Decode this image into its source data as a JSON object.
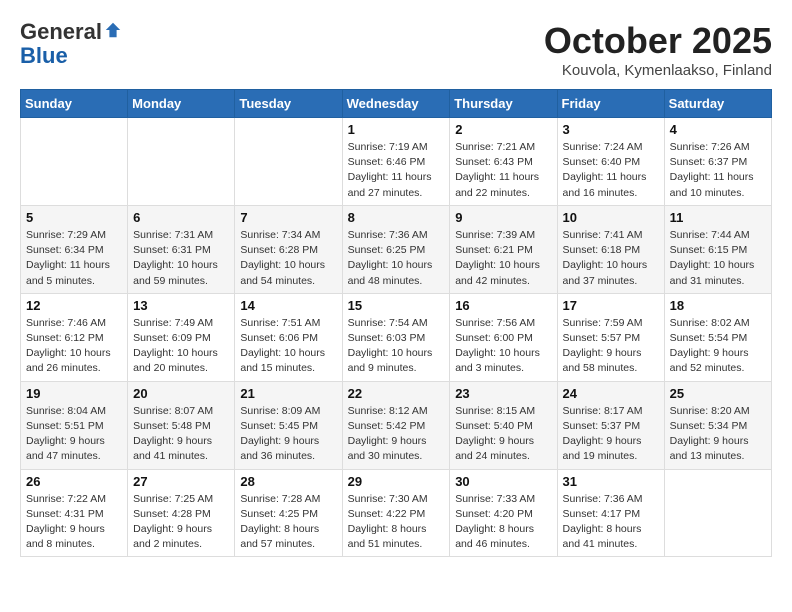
{
  "logo": {
    "general": "General",
    "blue": "Blue"
  },
  "header": {
    "month": "October 2025",
    "location": "Kouvola, Kymenlaakso, Finland"
  },
  "weekdays": [
    "Sunday",
    "Monday",
    "Tuesday",
    "Wednesday",
    "Thursday",
    "Friday",
    "Saturday"
  ],
  "weeks": [
    [
      {
        "day": "",
        "sunrise": "",
        "sunset": "",
        "daylight": ""
      },
      {
        "day": "",
        "sunrise": "",
        "sunset": "",
        "daylight": ""
      },
      {
        "day": "",
        "sunrise": "",
        "sunset": "",
        "daylight": ""
      },
      {
        "day": "1",
        "sunrise": "Sunrise: 7:19 AM",
        "sunset": "Sunset: 6:46 PM",
        "daylight": "Daylight: 11 hours and 27 minutes."
      },
      {
        "day": "2",
        "sunrise": "Sunrise: 7:21 AM",
        "sunset": "Sunset: 6:43 PM",
        "daylight": "Daylight: 11 hours and 22 minutes."
      },
      {
        "day": "3",
        "sunrise": "Sunrise: 7:24 AM",
        "sunset": "Sunset: 6:40 PM",
        "daylight": "Daylight: 11 hours and 16 minutes."
      },
      {
        "day": "4",
        "sunrise": "Sunrise: 7:26 AM",
        "sunset": "Sunset: 6:37 PM",
        "daylight": "Daylight: 11 hours and 10 minutes."
      }
    ],
    [
      {
        "day": "5",
        "sunrise": "Sunrise: 7:29 AM",
        "sunset": "Sunset: 6:34 PM",
        "daylight": "Daylight: 11 hours and 5 minutes."
      },
      {
        "day": "6",
        "sunrise": "Sunrise: 7:31 AM",
        "sunset": "Sunset: 6:31 PM",
        "daylight": "Daylight: 10 hours and 59 minutes."
      },
      {
        "day": "7",
        "sunrise": "Sunrise: 7:34 AM",
        "sunset": "Sunset: 6:28 PM",
        "daylight": "Daylight: 10 hours and 54 minutes."
      },
      {
        "day": "8",
        "sunrise": "Sunrise: 7:36 AM",
        "sunset": "Sunset: 6:25 PM",
        "daylight": "Daylight: 10 hours and 48 minutes."
      },
      {
        "day": "9",
        "sunrise": "Sunrise: 7:39 AM",
        "sunset": "Sunset: 6:21 PM",
        "daylight": "Daylight: 10 hours and 42 minutes."
      },
      {
        "day": "10",
        "sunrise": "Sunrise: 7:41 AM",
        "sunset": "Sunset: 6:18 PM",
        "daylight": "Daylight: 10 hours and 37 minutes."
      },
      {
        "day": "11",
        "sunrise": "Sunrise: 7:44 AM",
        "sunset": "Sunset: 6:15 PM",
        "daylight": "Daylight: 10 hours and 31 minutes."
      }
    ],
    [
      {
        "day": "12",
        "sunrise": "Sunrise: 7:46 AM",
        "sunset": "Sunset: 6:12 PM",
        "daylight": "Daylight: 10 hours and 26 minutes."
      },
      {
        "day": "13",
        "sunrise": "Sunrise: 7:49 AM",
        "sunset": "Sunset: 6:09 PM",
        "daylight": "Daylight: 10 hours and 20 minutes."
      },
      {
        "day": "14",
        "sunrise": "Sunrise: 7:51 AM",
        "sunset": "Sunset: 6:06 PM",
        "daylight": "Daylight: 10 hours and 15 minutes."
      },
      {
        "day": "15",
        "sunrise": "Sunrise: 7:54 AM",
        "sunset": "Sunset: 6:03 PM",
        "daylight": "Daylight: 10 hours and 9 minutes."
      },
      {
        "day": "16",
        "sunrise": "Sunrise: 7:56 AM",
        "sunset": "Sunset: 6:00 PM",
        "daylight": "Daylight: 10 hours and 3 minutes."
      },
      {
        "day": "17",
        "sunrise": "Sunrise: 7:59 AM",
        "sunset": "Sunset: 5:57 PM",
        "daylight": "Daylight: 9 hours and 58 minutes."
      },
      {
        "day": "18",
        "sunrise": "Sunrise: 8:02 AM",
        "sunset": "Sunset: 5:54 PM",
        "daylight": "Daylight: 9 hours and 52 minutes."
      }
    ],
    [
      {
        "day": "19",
        "sunrise": "Sunrise: 8:04 AM",
        "sunset": "Sunset: 5:51 PM",
        "daylight": "Daylight: 9 hours and 47 minutes."
      },
      {
        "day": "20",
        "sunrise": "Sunrise: 8:07 AM",
        "sunset": "Sunset: 5:48 PM",
        "daylight": "Daylight: 9 hours and 41 minutes."
      },
      {
        "day": "21",
        "sunrise": "Sunrise: 8:09 AM",
        "sunset": "Sunset: 5:45 PM",
        "daylight": "Daylight: 9 hours and 36 minutes."
      },
      {
        "day": "22",
        "sunrise": "Sunrise: 8:12 AM",
        "sunset": "Sunset: 5:42 PM",
        "daylight": "Daylight: 9 hours and 30 minutes."
      },
      {
        "day": "23",
        "sunrise": "Sunrise: 8:15 AM",
        "sunset": "Sunset: 5:40 PM",
        "daylight": "Daylight: 9 hours and 24 minutes."
      },
      {
        "day": "24",
        "sunrise": "Sunrise: 8:17 AM",
        "sunset": "Sunset: 5:37 PM",
        "daylight": "Daylight: 9 hours and 19 minutes."
      },
      {
        "day": "25",
        "sunrise": "Sunrise: 8:20 AM",
        "sunset": "Sunset: 5:34 PM",
        "daylight": "Daylight: 9 hours and 13 minutes."
      }
    ],
    [
      {
        "day": "26",
        "sunrise": "Sunrise: 7:22 AM",
        "sunset": "Sunset: 4:31 PM",
        "daylight": "Daylight: 9 hours and 8 minutes."
      },
      {
        "day": "27",
        "sunrise": "Sunrise: 7:25 AM",
        "sunset": "Sunset: 4:28 PM",
        "daylight": "Daylight: 9 hours and 2 minutes."
      },
      {
        "day": "28",
        "sunrise": "Sunrise: 7:28 AM",
        "sunset": "Sunset: 4:25 PM",
        "daylight": "Daylight: 8 hours and 57 minutes."
      },
      {
        "day": "29",
        "sunrise": "Sunrise: 7:30 AM",
        "sunset": "Sunset: 4:22 PM",
        "daylight": "Daylight: 8 hours and 51 minutes."
      },
      {
        "day": "30",
        "sunrise": "Sunrise: 7:33 AM",
        "sunset": "Sunset: 4:20 PM",
        "daylight": "Daylight: 8 hours and 46 minutes."
      },
      {
        "day": "31",
        "sunrise": "Sunrise: 7:36 AM",
        "sunset": "Sunset: 4:17 PM",
        "daylight": "Daylight: 8 hours and 41 minutes."
      },
      {
        "day": "",
        "sunrise": "",
        "sunset": "",
        "daylight": ""
      }
    ]
  ]
}
